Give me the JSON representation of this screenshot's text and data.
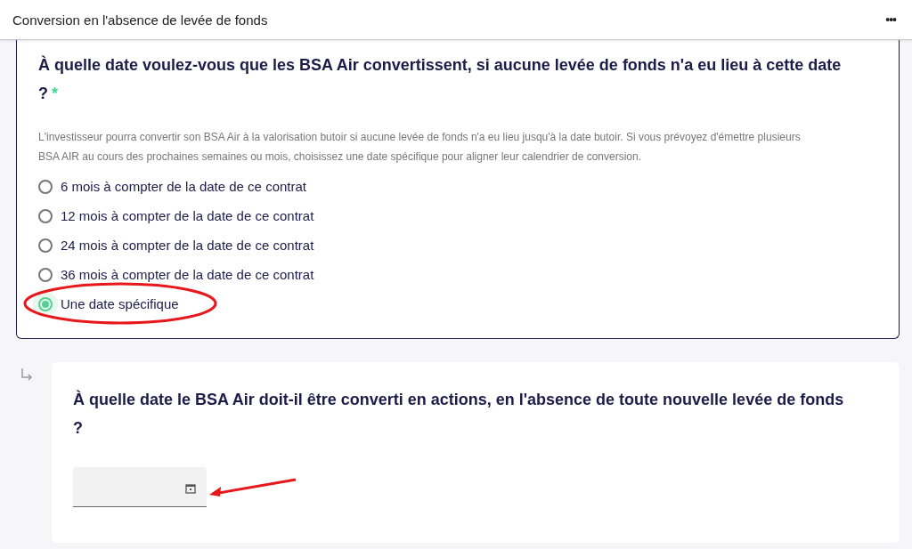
{
  "header": {
    "title": "Conversion en l'absence de levée de fonds",
    "menu_icon": "•••"
  },
  "question": {
    "title": "À quelle date voulez-vous que les BSA Air convertissent, si aucune levée de fonds n'a eu lieu à cette date ?",
    "required_mark": "*",
    "description": "L'investisseur pourra convertir son BSA Air à la valorisation butoir si aucune levée de fonds n'a eu lieu jusqu'à la date butoir. Si vous prévoyez d'émettre plusieurs BSA AIR au cours des prochaines semaines ou mois, choisissez une date spécifique pour aligner leur calendrier de conversion.",
    "options": [
      {
        "label": "6 mois à compter de la date de ce contrat",
        "selected": false
      },
      {
        "label": "12 mois à compter de la date de ce contrat",
        "selected": false
      },
      {
        "label": "24 mois à compter de la date de ce contrat",
        "selected": false
      },
      {
        "label": "36 mois à compter de la date de ce contrat",
        "selected": false
      },
      {
        "label": "Une date spécifique",
        "selected": true
      }
    ]
  },
  "followup": {
    "title": "À quelle date le BSA Air doit-il être converti en actions, en l'absence de toute nouvelle levée de fonds ?"
  }
}
